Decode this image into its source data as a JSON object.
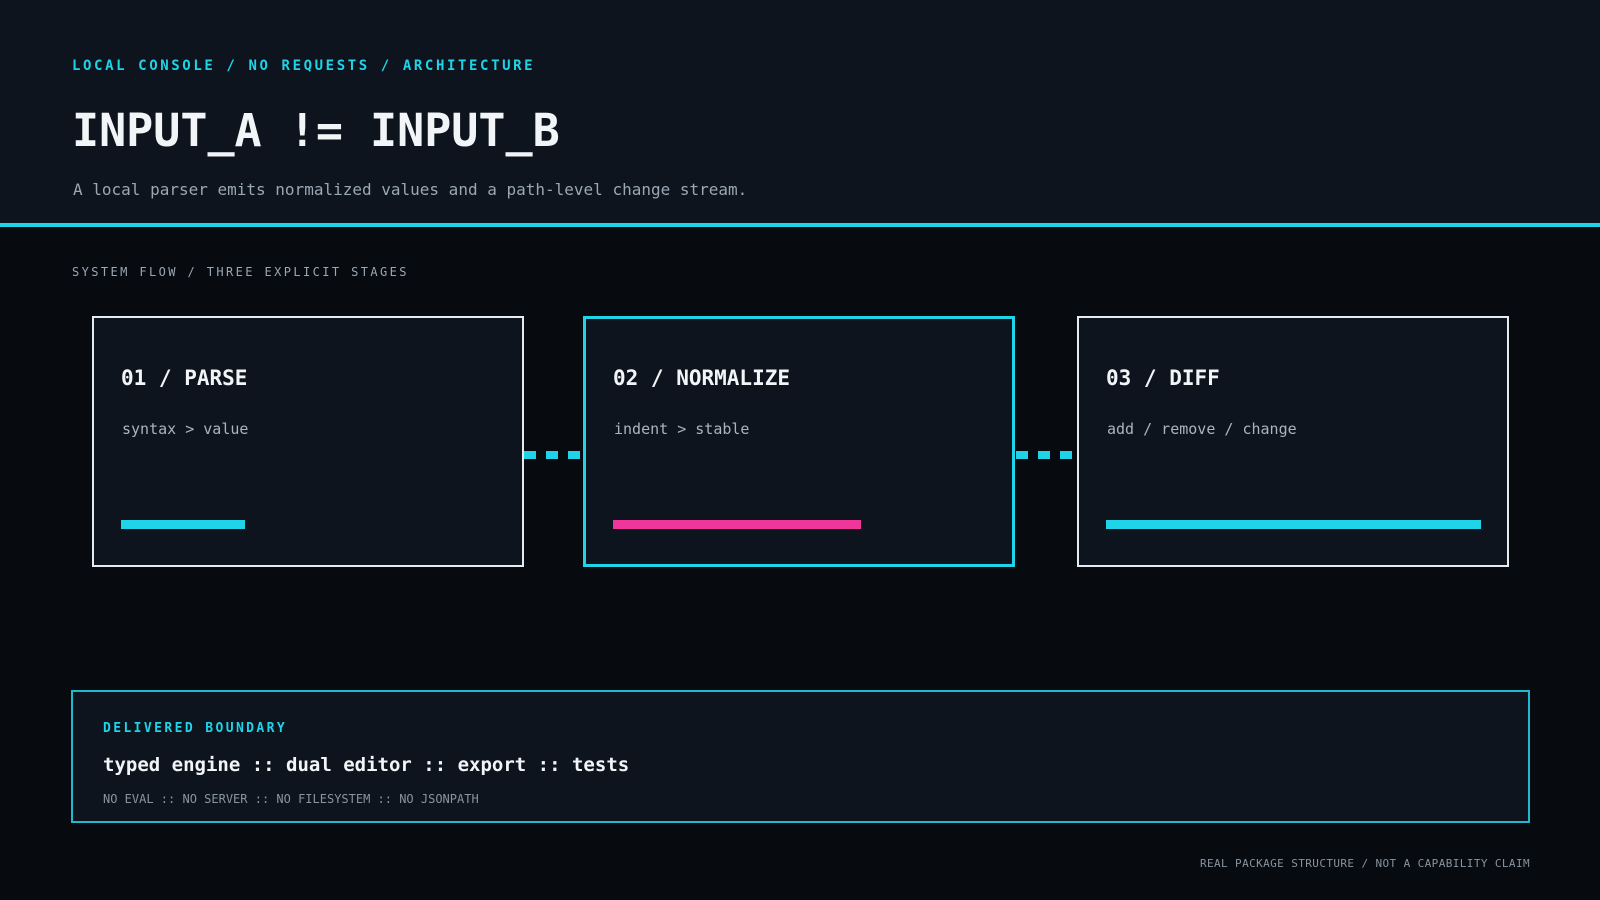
{
  "header": {
    "breadcrumb": "LOCAL CONSOLE / NO REQUESTS / ARCHITECTURE",
    "title": "INPUT_A != INPUT_B",
    "subtitle": "A local parser emits normalized values and a path-level change stream."
  },
  "flow": {
    "label": "SYSTEM FLOW / THREE EXPLICIT STAGES",
    "stages": [
      {
        "title": "01 / PARSE",
        "description": "syntax > value",
        "bar_color": "#1fd3e8",
        "bar_fill": 0.33
      },
      {
        "title": "02 / NORMALIZE",
        "description": "indent > stable",
        "bar_color": "#f0369a",
        "bar_fill": 0.66
      },
      {
        "title": "03 / DIFF",
        "description": "add / remove / change",
        "bar_color": "#1fd3e8",
        "bar_fill": 1.0
      }
    ],
    "active_stage": 1
  },
  "boundary": {
    "label": "DELIVERED BOUNDARY",
    "main": "typed engine :: dual editor :: export :: tests",
    "note": "NO EVAL :: NO SERVER :: NO FILESYSTEM :: NO JSONPATH"
  },
  "footer": {
    "note": "REAL PACKAGE STRUCTURE / NOT A CAPABILITY CLAIM"
  },
  "colors": {
    "accent": "#1fd3e8",
    "highlight": "#f0369a",
    "background": "#070a0f",
    "panel": "#0e141d"
  }
}
